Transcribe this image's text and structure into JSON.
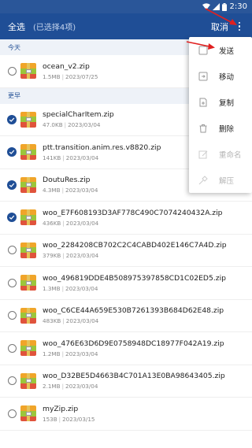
{
  "status_bar": {
    "time": "2:30"
  },
  "top_bar": {
    "select_all": "全选",
    "selected_count": "(已选择4项)",
    "cancel": "取消",
    "more_icon": "more-vert-icon"
  },
  "sections": [
    {
      "header": "今天",
      "items": [
        {
          "name": "ocean_v2.zip",
          "size": "1.5MB",
          "date": "2023/07/25",
          "checked": false
        }
      ]
    },
    {
      "header": "更早",
      "items": [
        {
          "name": "specialCharItem.zip",
          "size": "47.0KB",
          "date": "2023/03/04",
          "checked": true
        },
        {
          "name": "ptt.transition.anim.res.v8820.zip",
          "size": "141KB",
          "date": "2023/03/04",
          "checked": true
        },
        {
          "name": "DoutuRes.zip",
          "size": "4.3MB",
          "date": "2023/03/04",
          "checked": true
        },
        {
          "name": "woo_E7F608193D3AF778C490C7074240432A.zip",
          "size": "436KB",
          "date": "2023/03/04",
          "checked": true
        },
        {
          "name": "woo_2284208CB702C2C4CABD402E146C7A4D.zip",
          "size": "379KB",
          "date": "2023/03/04",
          "checked": false
        },
        {
          "name": "woo_496819DDE4B508975397858CD1C02ED5.zip",
          "size": "1.3MB",
          "date": "2023/03/04",
          "checked": false
        },
        {
          "name": "woo_C6CE44A659E530B7261393B684D62E48.zip",
          "size": "483KB",
          "date": "2023/03/04",
          "checked": false
        },
        {
          "name": "woo_476E63D6D9E0758948DC18977F042A19.zip",
          "size": "1.2MB",
          "date": "2023/03/04",
          "checked": false
        },
        {
          "name": "woo_D32BE5D4663B4C701A13E0BA98643405.zip",
          "size": "2.1MB",
          "date": "2023/03/04",
          "checked": false
        },
        {
          "name": "myZip.zip",
          "size": "153B",
          "date": "2023/03/15",
          "checked": false
        }
      ]
    }
  ],
  "menu": [
    {
      "label": "发送",
      "icon": "send-icon",
      "disabled": false
    },
    {
      "label": "移动",
      "icon": "move-icon",
      "disabled": false
    },
    {
      "label": "复制",
      "icon": "copy-icon",
      "disabled": false
    },
    {
      "label": "删除",
      "icon": "delete-icon",
      "disabled": false
    },
    {
      "label": "重命名",
      "icon": "rename-icon",
      "disabled": true
    },
    {
      "label": "解压",
      "icon": "extract-icon",
      "disabled": true
    }
  ],
  "colors": {
    "header_blue": "#1f4e96",
    "checked_blue": "#1f4e96",
    "annotation_red": "#e02020",
    "zip_stripes": [
      "#f0a52a",
      "#9bc63b",
      "#e0533c"
    ]
  }
}
